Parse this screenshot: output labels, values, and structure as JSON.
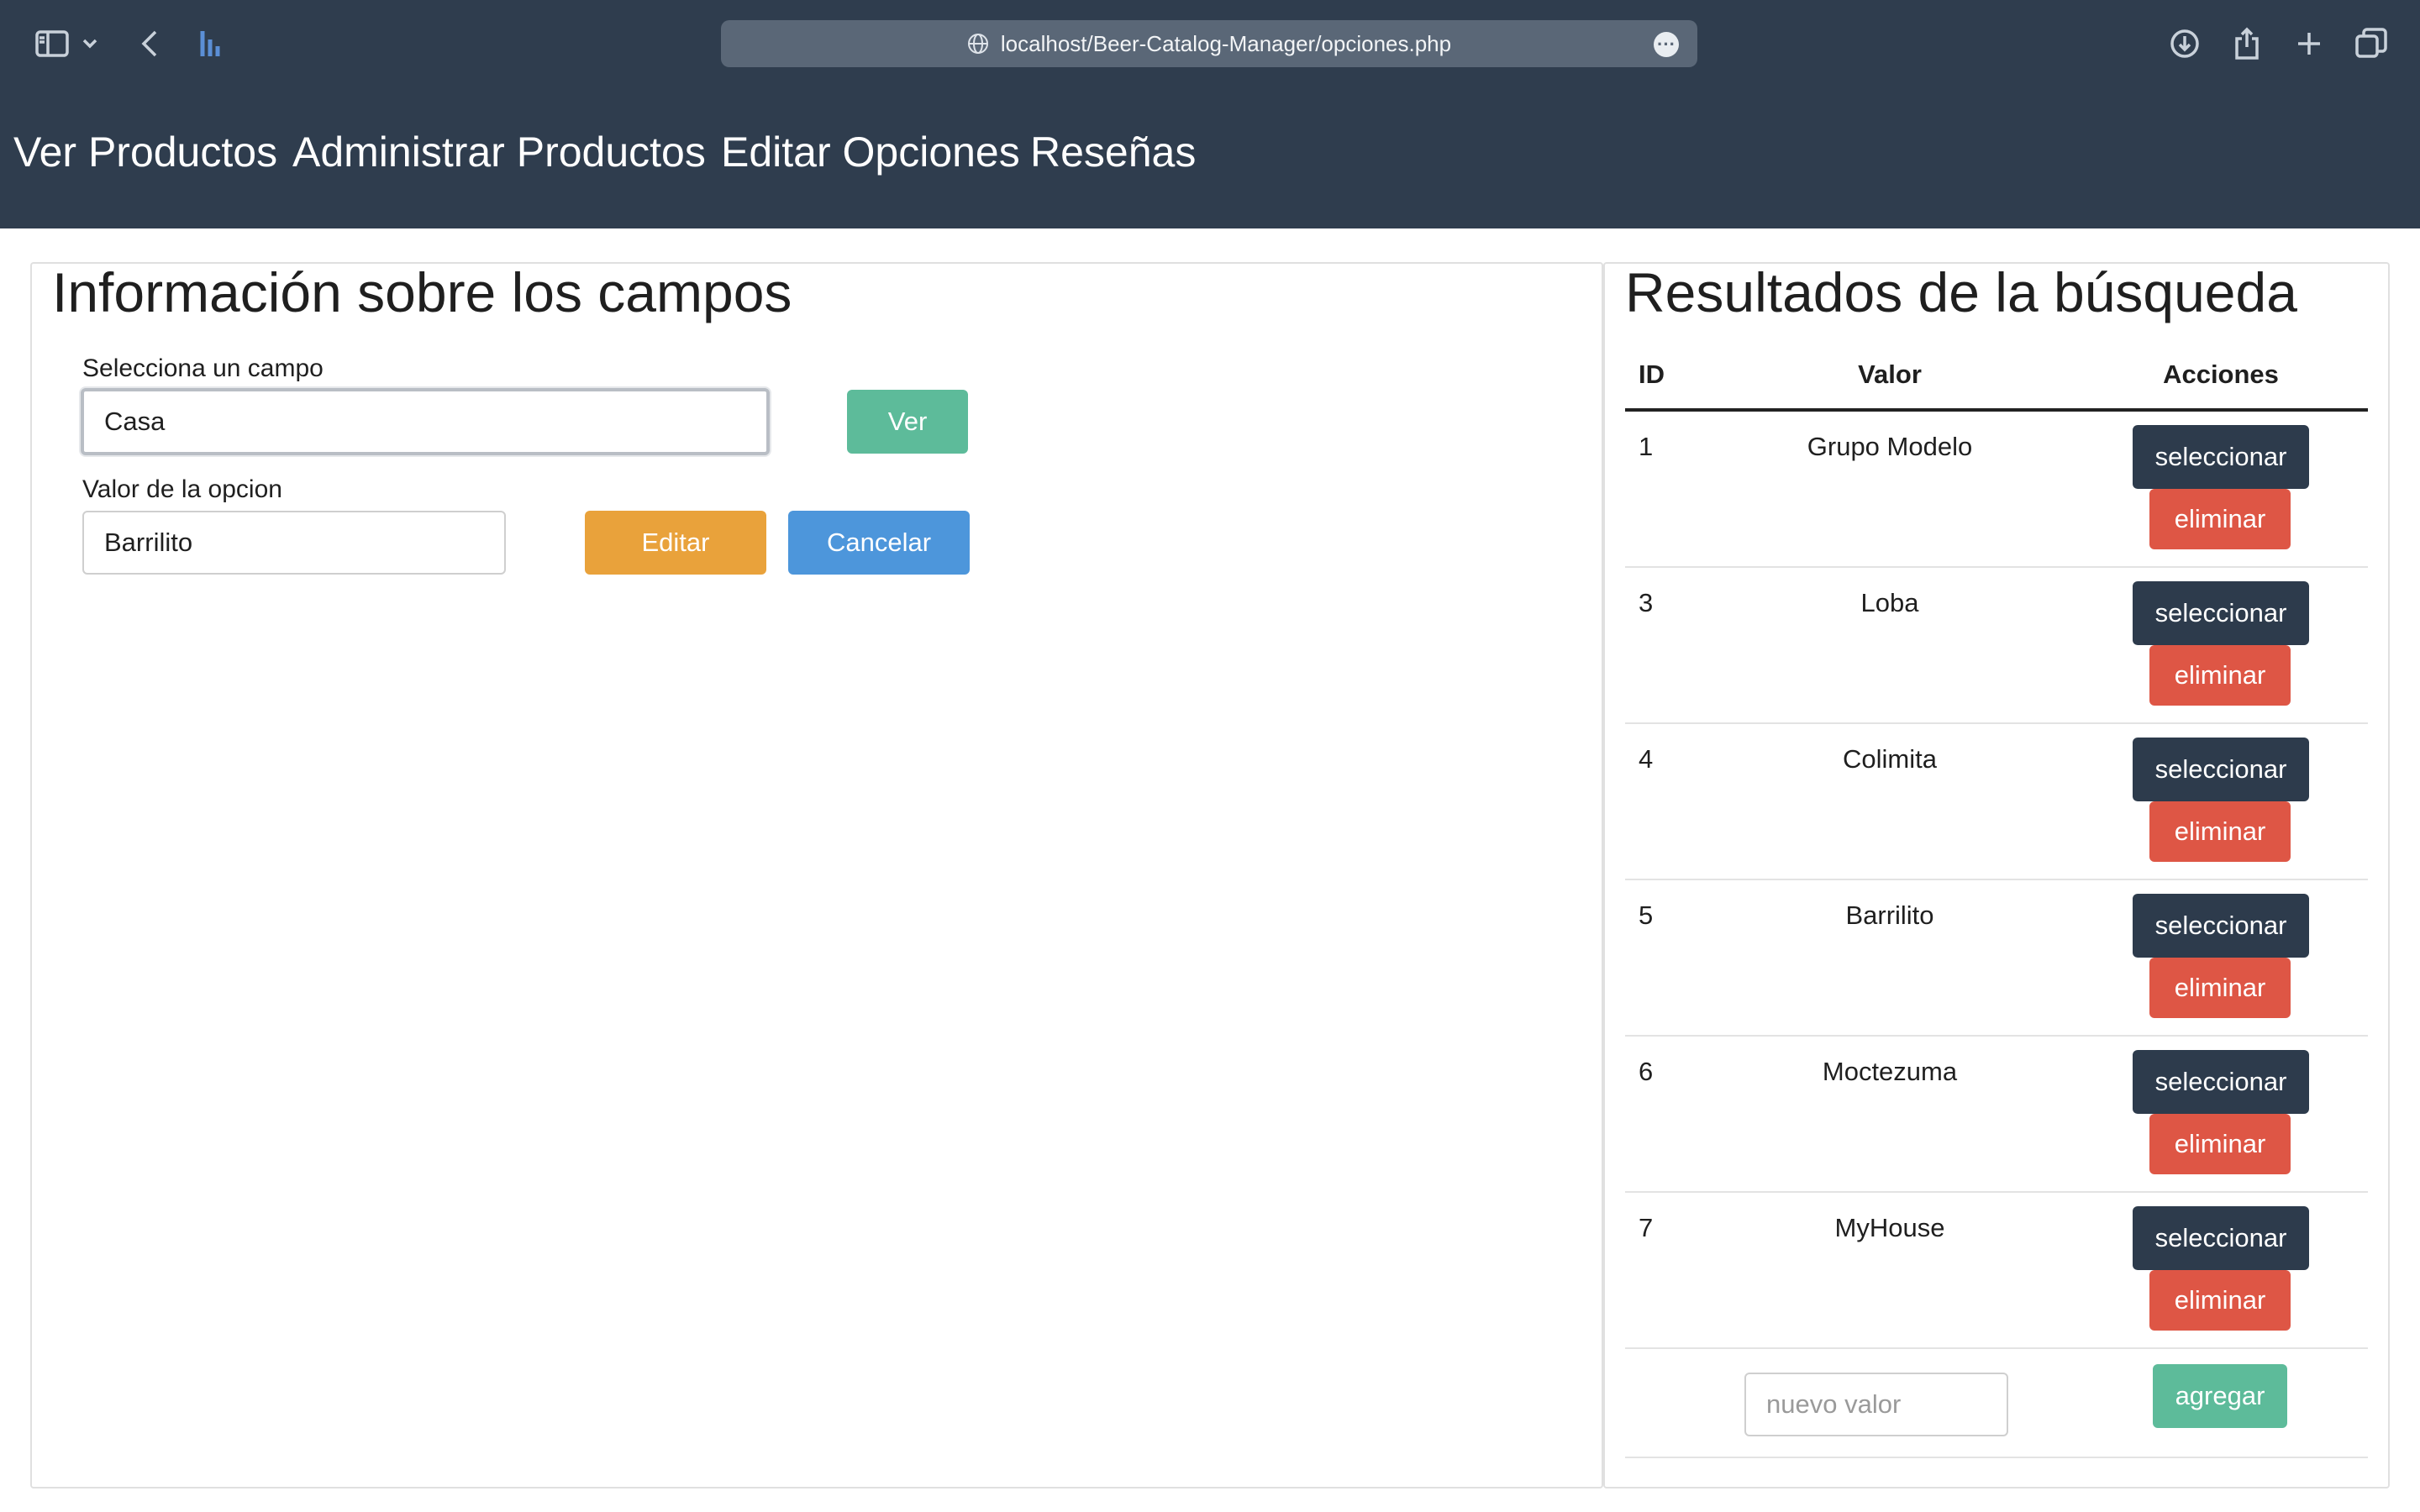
{
  "browser": {
    "url": "localhost/Beer-Catalog-Manager/opciones.php"
  },
  "nav": {
    "items": [
      "Ver Productos",
      "Administrar Productos",
      "Editar Opciones",
      "Reseñas"
    ]
  },
  "left": {
    "title": "Información sobre los campos",
    "select_label": "Selecciona un campo",
    "select_value": "Casa",
    "ver_button": "Ver",
    "option_label": "Valor de la opcion",
    "option_value": "Barrilito",
    "edit_button": "Editar",
    "cancel_button": "Cancelar"
  },
  "right": {
    "title": "Resultados de la búsqueda",
    "columns": [
      "ID",
      "Valor",
      "Acciones"
    ],
    "rows": [
      {
        "id": "1",
        "valor": "Grupo Modelo"
      },
      {
        "id": "3",
        "valor": "Loba"
      },
      {
        "id": "4",
        "valor": "Colimita"
      },
      {
        "id": "5",
        "valor": "Barrilito"
      },
      {
        "id": "6",
        "valor": "Moctezuma"
      },
      {
        "id": "7",
        "valor": "MyHouse"
      }
    ],
    "select_label": "seleccionar",
    "delete_label": "eliminar",
    "new_placeholder": "nuevo valor",
    "add_button": "agregar"
  },
  "colors": {
    "header_bg": "#2f3d4e",
    "green": "#5dbb9a",
    "orange": "#e9a23b",
    "blue": "#4d96db",
    "dark": "#2d3b4c",
    "red": "#de5645"
  }
}
